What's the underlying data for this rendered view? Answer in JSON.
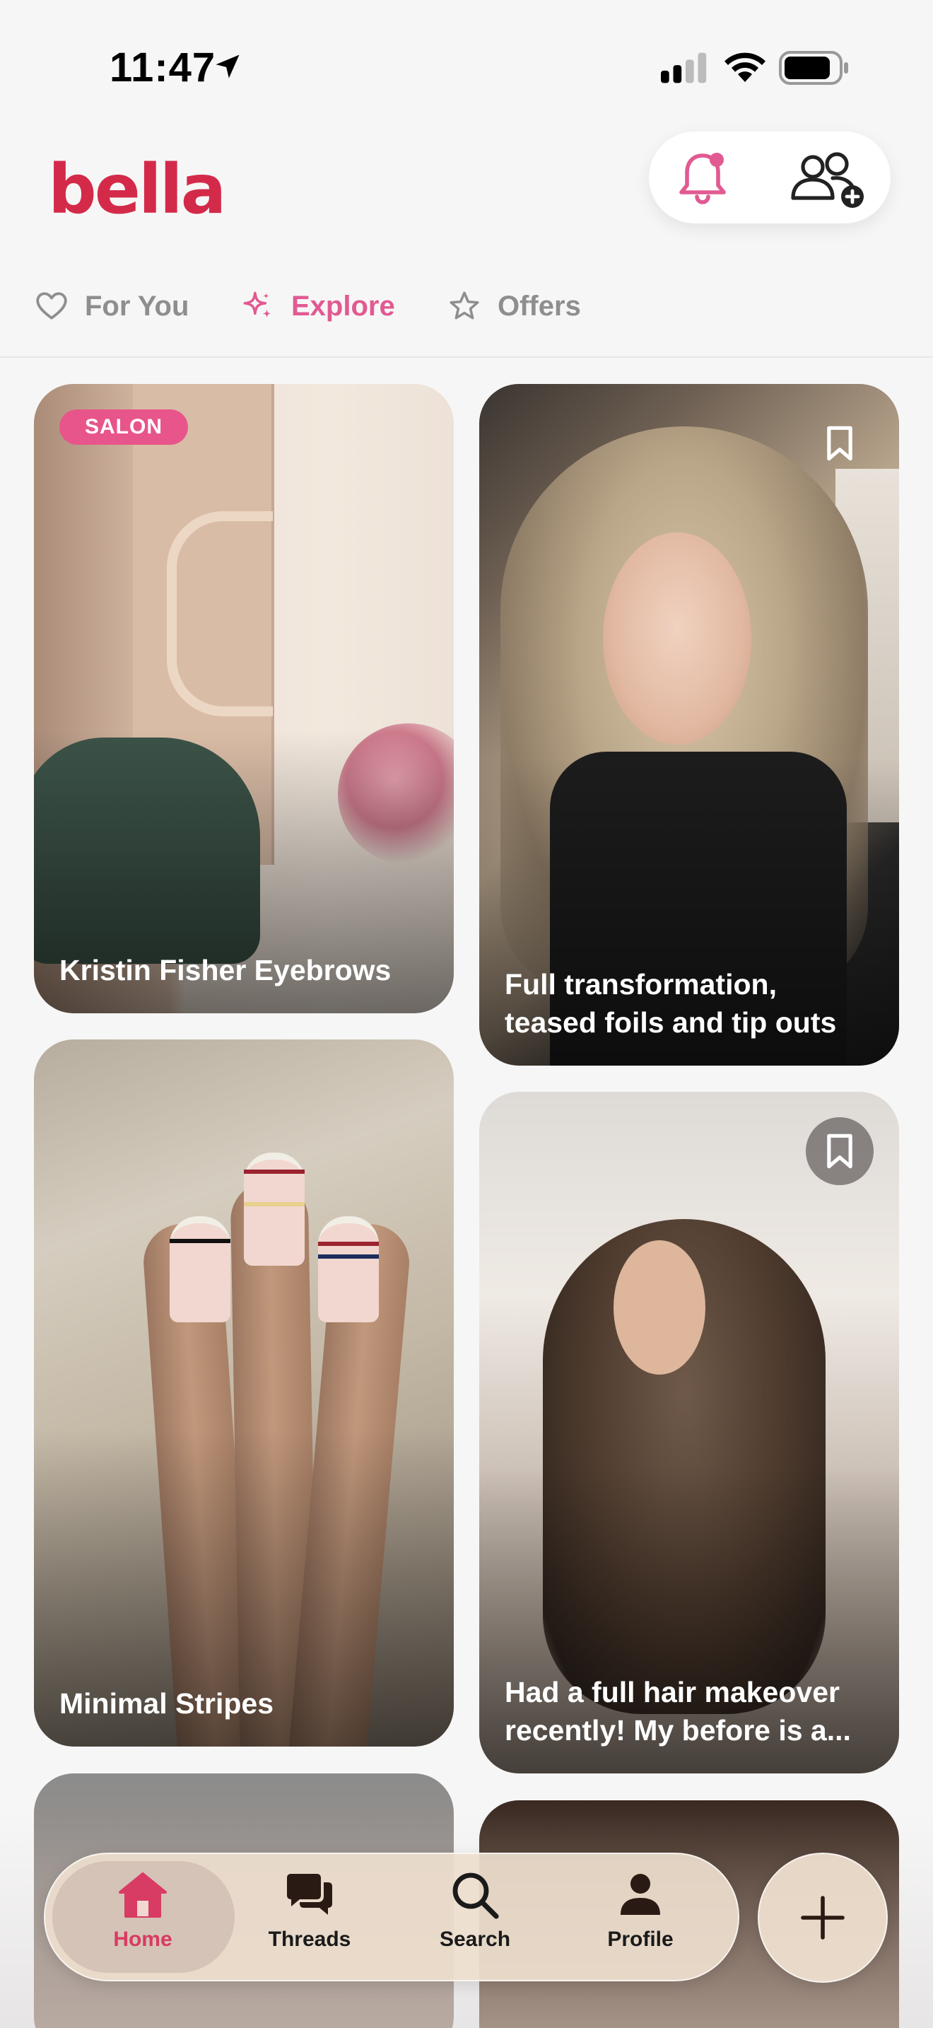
{
  "status_bar": {
    "time": "11:47"
  },
  "header": {
    "logo": "bella"
  },
  "tabs": [
    {
      "label": "For You",
      "icon": "heart-icon",
      "active": false
    },
    {
      "label": "Explore",
      "icon": "sparkle-icon",
      "active": true
    },
    {
      "label": "Offers",
      "icon": "star-icon",
      "active": false
    }
  ],
  "cards": [
    {
      "badge": "SALON",
      "title": "Kristin Fisher Eyebrows"
    },
    {
      "title": "Full transformation, teased foils and tip outs",
      "bookmark": true
    },
    {
      "title": "Minimal Stripes"
    },
    {
      "title": "Had a full hair makeover recently! My before is a...",
      "bookmark": true
    }
  ],
  "tab_bar": {
    "items": [
      {
        "label": "Home",
        "icon": "home-icon",
        "active": true
      },
      {
        "label": "Threads",
        "icon": "threads-icon",
        "active": false
      },
      {
        "label": "Search",
        "icon": "search-icon",
        "active": false
      },
      {
        "label": "Profile",
        "icon": "profile-icon",
        "active": false
      }
    ],
    "fab_icon": "plus-icon"
  },
  "colors": {
    "brand": "#d42a4a",
    "accent_pink": "#e15a91",
    "active_tab": "#d83b63",
    "badge": "#e8558a"
  }
}
